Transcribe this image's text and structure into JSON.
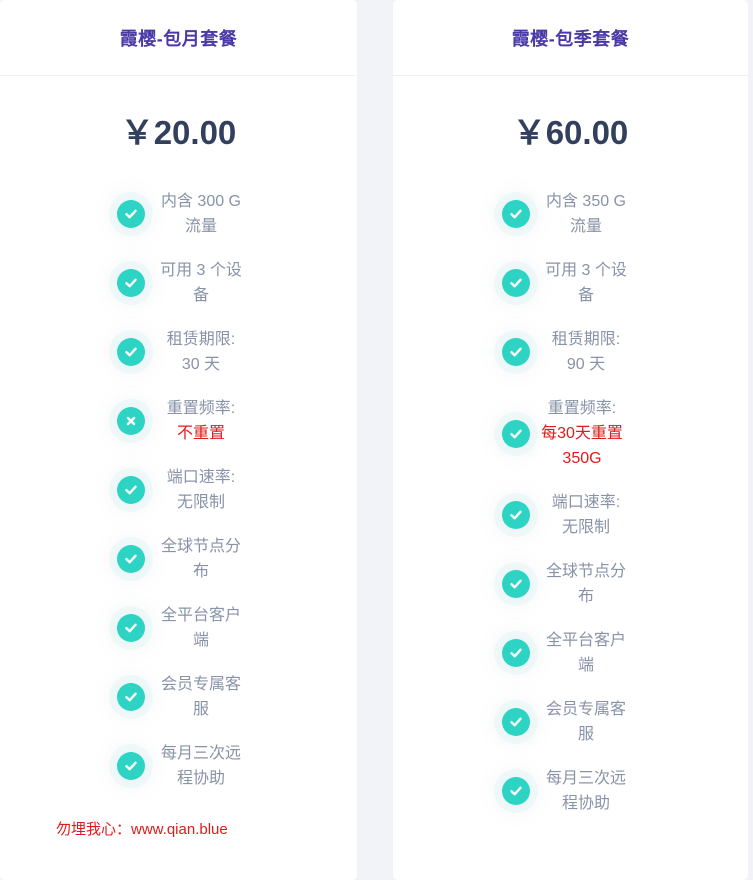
{
  "colors": {
    "title": "#4a3aa8",
    "price": "#32405d",
    "feature_text": "#8893a7",
    "check_bg": "#2dd4c4",
    "highlight": "#e01b1b"
  },
  "plans": [
    {
      "title": "霞樱-包月套餐",
      "price": "￥20.00",
      "features": [
        {
          "icon": "check-icon",
          "line1": "内含 300 G",
          "line2": "流量"
        },
        {
          "icon": "check-icon",
          "line1": "可用 3 个设",
          "line2": "备"
        },
        {
          "icon": "check-icon",
          "line1": "租赁期限:",
          "line2": "30 天"
        },
        {
          "icon": "close-icon",
          "line1": "重置频率:",
          "line2": "不重置"
        },
        {
          "icon": "check-icon",
          "line1": "端口速率:",
          "line2": "无限制"
        },
        {
          "icon": "check-icon",
          "line1": "全球节点分",
          "line2": "布"
        },
        {
          "icon": "check-icon",
          "line1": "全平台客户",
          "line2": "端"
        },
        {
          "icon": "check-icon",
          "line1": "会员专属客",
          "line2": "服"
        },
        {
          "icon": "check-icon",
          "line1": "每月三次远",
          "line2": "程协助"
        }
      ],
      "footer": "勿埋我心：www.qian.blue"
    },
    {
      "title": "霞樱-包季套餐",
      "price": "￥60.00",
      "features": [
        {
          "icon": "check-icon",
          "line1": "内含 350 G",
          "line2": "流量"
        },
        {
          "icon": "check-icon",
          "line1": "可用 3 个设",
          "line2": "备"
        },
        {
          "icon": "check-icon",
          "line1": "租赁期限:",
          "line2": "90 天"
        },
        {
          "icon": "check-icon",
          "line1": "重置频率:",
          "line2": "每30天重置",
          "line3": "350G"
        },
        {
          "icon": "check-icon",
          "line1": "端口速率:",
          "line2": "无限制"
        },
        {
          "icon": "check-icon",
          "line1": "全球节点分",
          "line2": "布"
        },
        {
          "icon": "check-icon",
          "line1": "全平台客户",
          "line2": "端"
        },
        {
          "icon": "check-icon",
          "line1": "会员专属客",
          "line2": "服"
        },
        {
          "icon": "check-icon",
          "line1": "每月三次远",
          "line2": "程协助"
        }
      ]
    }
  ]
}
